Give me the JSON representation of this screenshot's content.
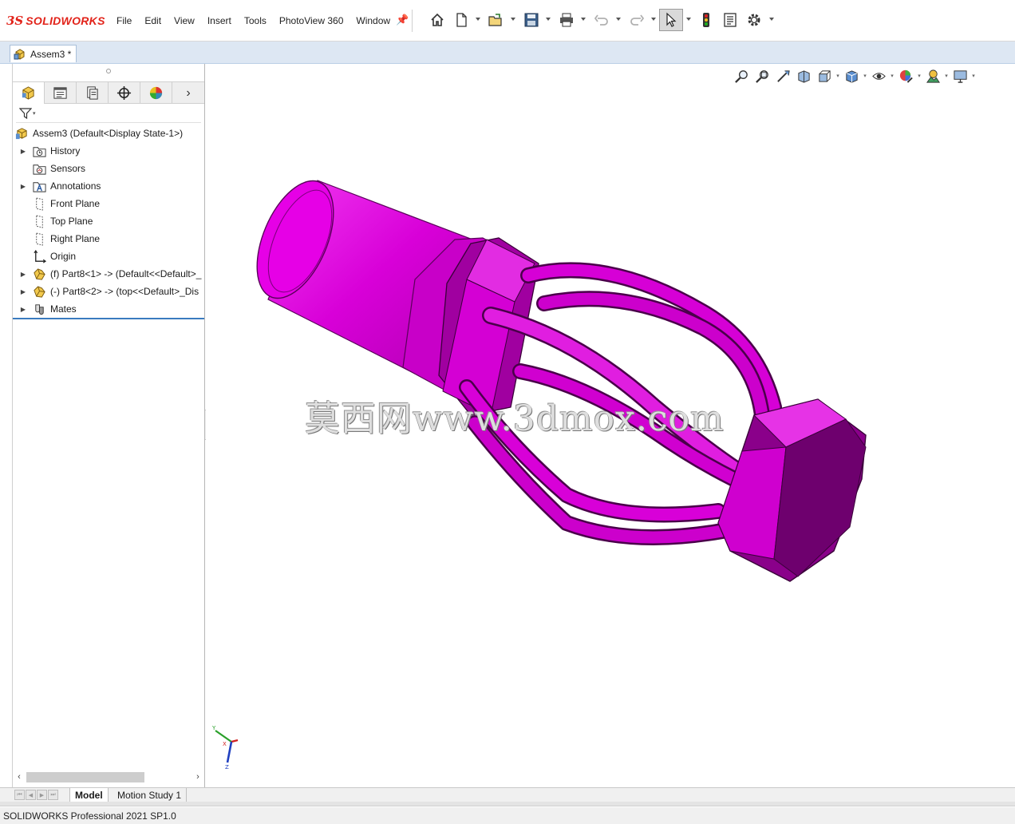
{
  "app": {
    "logo_mark": "3S",
    "logo_text": "SOLIDWORKS"
  },
  "menu": [
    "File",
    "Edit",
    "View",
    "Insert",
    "Tools",
    "PhotoView 360",
    "Window"
  ],
  "toolbar_icons": [
    "home-icon",
    "new-document-icon",
    "open-icon",
    "save-icon",
    "print-icon",
    "undo-icon",
    "redo-icon",
    "select-arrow-icon",
    "rebuild-icon",
    "file-properties-icon",
    "options-gear-icon"
  ],
  "document": {
    "tab_title": "Assem3 *"
  },
  "feature_tree": {
    "tabs": [
      "featuremanager-icon",
      "propertymanager-icon",
      "configurationmanager-icon",
      "dimxpert-icon",
      "display-manager-icon"
    ],
    "root": "Assem3  (Default<Display State-1>)",
    "items": [
      {
        "label": "History",
        "icon": "history-icon",
        "expandable": true
      },
      {
        "label": "Sensors",
        "icon": "sensors-icon",
        "expandable": false
      },
      {
        "label": "Annotations",
        "icon": "annotations-icon",
        "expandable": true
      },
      {
        "label": "Front Plane",
        "icon": "plane-icon",
        "expandable": false
      },
      {
        "label": "Top Plane",
        "icon": "plane-icon",
        "expandable": false
      },
      {
        "label": "Right Plane",
        "icon": "plane-icon",
        "expandable": false
      },
      {
        "label": "Origin",
        "icon": "origin-icon",
        "expandable": false
      },
      {
        "label": "(f) Part8<1> -> (Default<<Default>_",
        "icon": "part-icon",
        "expandable": true
      },
      {
        "label": "(-) Part8<2> -> (top<<Default>_Dis",
        "icon": "part-icon",
        "expandable": true
      },
      {
        "label": "Mates",
        "icon": "mates-icon",
        "expandable": true
      }
    ]
  },
  "heads_up_toolbar": [
    "zoom-to-fit-icon",
    "zoom-to-area-icon",
    "previous-view-icon",
    "section-view-icon",
    "view-orientation-icon",
    "display-style-icon",
    "hide-show-icon",
    "edit-appearance-icon",
    "apply-scene-icon",
    "view-settings-icon"
  ],
  "viewport": {
    "watermark": "莫西网www.3dmox.com",
    "model_color": "#e600e6",
    "triad": {
      "x_label": "X",
      "y_label": "Y",
      "z_label": "Z"
    }
  },
  "bottom_tabs": [
    {
      "label": "Model",
      "selected": true
    },
    {
      "label": "Motion Study 1",
      "selected": false
    }
  ],
  "status": {
    "text": "SOLIDWORKS Professional 2021 SP1.0"
  },
  "colors": {
    "accent": "#e2231a",
    "tree_end_line": "#3a7bbf",
    "doc_bar": "#dde7f3"
  }
}
